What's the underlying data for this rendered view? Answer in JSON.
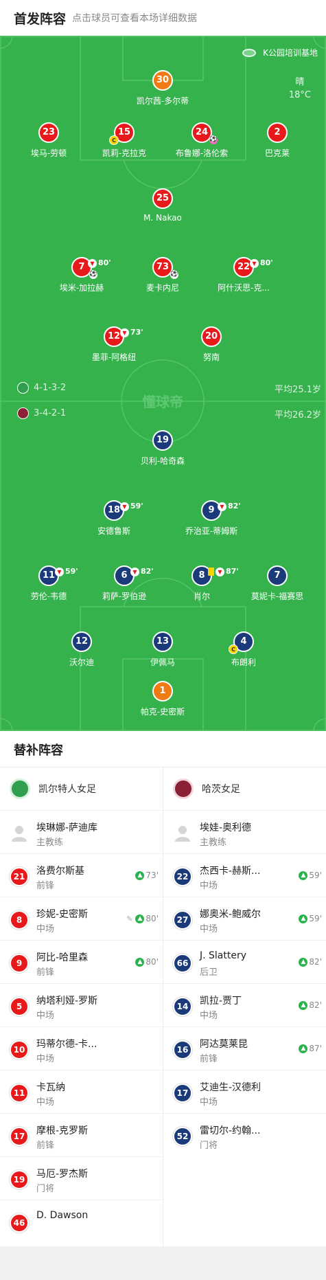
{
  "header": {
    "title": "首发阵容",
    "subtitle": "点击球员可查看本场详细数据"
  },
  "venue": {
    "name": "K公园培训基地",
    "icon": "stadium-icon"
  },
  "weather": {
    "condition": "晴",
    "temp": "18°C"
  },
  "watermark": "懂球帝",
  "home_team": {
    "name": "凯尔特人女足",
    "formation": "4-1-3-2",
    "avg_age": "平均25.1岁",
    "color": "#e8191a",
    "coach": {
      "name": "埃琳娜-萨迪库",
      "role": "主教练"
    }
  },
  "away_team": {
    "name": "哈茨女足",
    "formation": "3-4-2-1",
    "avg_age": "平均26.2岁",
    "color": "#1a3a7a",
    "coach": {
      "name": "埃娃-奥利德",
      "role": "主教练"
    }
  },
  "home_lineup": [
    {
      "number": "30",
      "name": "凯尔茜-多尔蒂",
      "gk": true
    },
    {
      "number": "23",
      "name": "埃马-劳顿"
    },
    {
      "number": "15",
      "name": "凯莉-克拉克",
      "captain": "C"
    },
    {
      "number": "24",
      "name": "布鲁娜-洛伦索",
      "event": "own-goal"
    },
    {
      "number": "2",
      "name": "巴克莱"
    },
    {
      "number": "25",
      "name": "M. Nakao"
    },
    {
      "number": "7",
      "name": "埃米-加拉赫",
      "event": "goal",
      "sub_time": "80'"
    },
    {
      "number": "73",
      "name": "麦卡内尼",
      "event": "goal"
    },
    {
      "number": "22",
      "name": "阿什沃思-克...",
      "sub_time": "80'"
    },
    {
      "number": "12",
      "name": "墨菲-阿格纽",
      "sub_time": "73'"
    },
    {
      "number": "20",
      "name": "努南"
    }
  ],
  "away_lineup": [
    {
      "number": "19",
      "name": "贝利-哈奇森"
    },
    {
      "number": "18",
      "name": "安德鲁斯",
      "sub_time": "59'"
    },
    {
      "number": "9",
      "name": "乔治亚-蒂姆斯",
      "sub_time": "82'"
    },
    {
      "number": "11",
      "name": "劳伦-韦德",
      "sub_time": "59'"
    },
    {
      "number": "6",
      "name": "莉萨-罗伯逊",
      "sub_time": "82'"
    },
    {
      "number": "8",
      "name": "肖尔",
      "yellow": true,
      "sub_time": "87'"
    },
    {
      "number": "7",
      "name": "莫妮卡-福赛思"
    },
    {
      "number": "12",
      "name": "沃尔迪"
    },
    {
      "number": "13",
      "name": "伊佩马"
    },
    {
      "number": "4",
      "name": "布朗利",
      "captain": "C"
    },
    {
      "number": "1",
      "name": "帕克-史密斯",
      "gk": true
    }
  ],
  "subs_title": "替补阵容",
  "home_subs": [
    {
      "number": "21",
      "name": "洛费尔斯基",
      "position": "前锋",
      "in": "73'"
    },
    {
      "number": "8",
      "name": "珍妮-史密斯",
      "position": "中场",
      "in": "80'",
      "assist": true
    },
    {
      "number": "9",
      "name": "阿比-哈里森",
      "position": "前锋",
      "in": "80'"
    },
    {
      "number": "5",
      "name": "纳塔利娅-罗斯",
      "position": "中场"
    },
    {
      "number": "10",
      "name": "玛蒂尔德-卡...",
      "position": "中场"
    },
    {
      "number": "11",
      "name": "卡瓦纳",
      "position": "中场"
    },
    {
      "number": "17",
      "name": "摩根-克罗斯",
      "position": "前锋"
    },
    {
      "number": "19",
      "name": "马厄-罗杰斯",
      "position": "门将"
    },
    {
      "number": "46",
      "name": "D. Dawson",
      "position": ""
    }
  ],
  "away_subs": [
    {
      "number": "22",
      "name": "杰西卡-赫斯...",
      "position": "中场",
      "in": "59'"
    },
    {
      "number": "27",
      "name": "娜奥米-鲍威尔",
      "position": "中场",
      "in": "59'"
    },
    {
      "number": "66",
      "name": "J. Slattery",
      "position": "后卫",
      "in": "82'"
    },
    {
      "number": "14",
      "name": "凯拉-贾丁",
      "position": "中场",
      "in": "82'"
    },
    {
      "number": "16",
      "name": "阿达莫莱昆",
      "position": "前锋",
      "in": "87'"
    },
    {
      "number": "17",
      "name": "艾迪生-汉德利",
      "position": "中场"
    },
    {
      "number": "52",
      "name": "雷切尔-约翰...",
      "position": "门将"
    }
  ]
}
